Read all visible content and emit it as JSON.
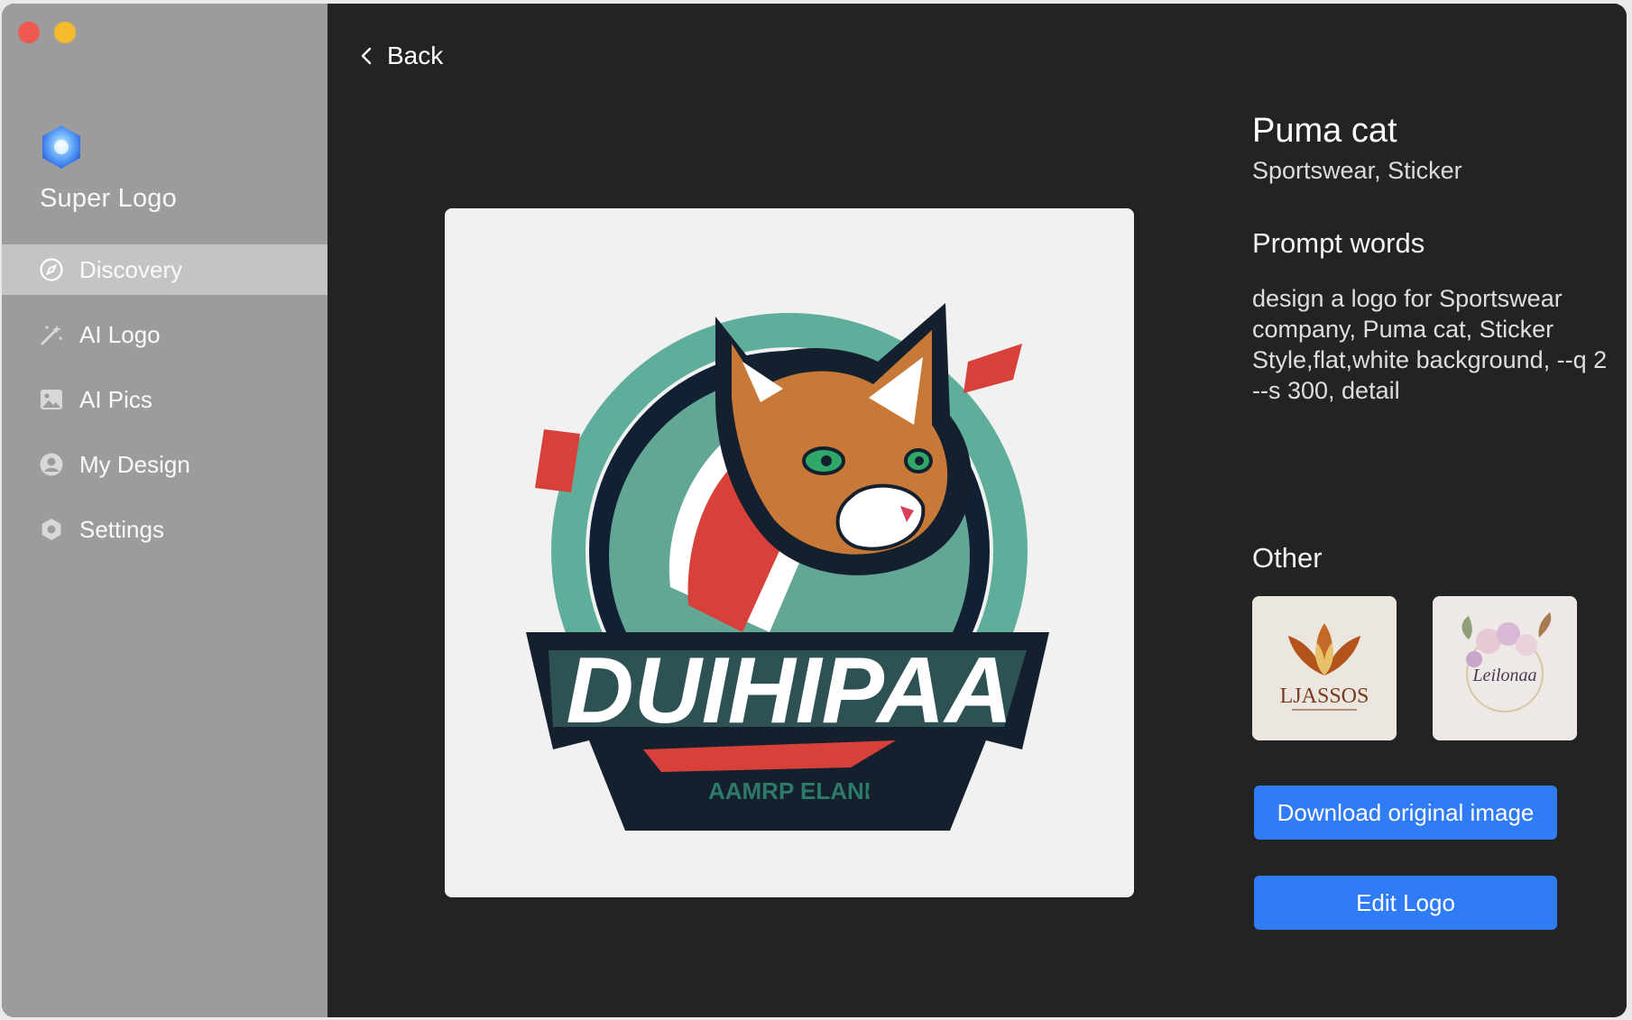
{
  "app": {
    "name": "Super Logo",
    "icon": "app-logo-icon"
  },
  "sidebar": {
    "items": [
      {
        "label": "Discovery",
        "icon": "compass-icon",
        "active": true
      },
      {
        "label": "AI Logo",
        "icon": "magic-wand-icon",
        "active": false
      },
      {
        "label": "AI Pics",
        "icon": "image-icon",
        "active": false
      },
      {
        "label": "My Design",
        "icon": "user-icon",
        "active": false
      },
      {
        "label": "Settings",
        "icon": "gear-icon",
        "active": false
      }
    ]
  },
  "header": {
    "back_label": "Back"
  },
  "preview": {
    "wordmark": "DUIHIPAA",
    "tagline": "AAMRP ELANI"
  },
  "detail": {
    "title": "Puma cat",
    "tags": "Sportswear, Sticker",
    "prompt_heading": "Prompt words",
    "prompt_text": "design a logo for Sportswear company, Puma cat, Sticker Style,flat,white background, --q 2 --s 300, detail",
    "other_heading": "Other",
    "other_thumbs": [
      {
        "caption": "LJASSOS",
        "icon": "lotus-logo-thumbnail"
      },
      {
        "caption": "Leilonaa",
        "icon": "floral-logo-thumbnail"
      }
    ],
    "download_label": "Download original image",
    "edit_label": "Edit Logo"
  },
  "colors": {
    "sidebar_bg": "#9c9c9c",
    "sidebar_active": "#c4c4c4",
    "main_bg": "#232323",
    "accent": "#2f7cf6"
  }
}
